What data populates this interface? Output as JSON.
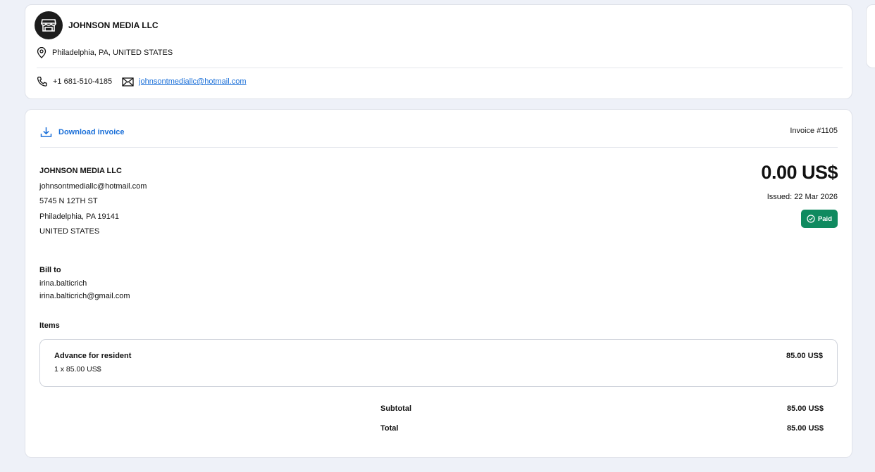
{
  "merchant": {
    "name": "JOHNSON MEDIA LLC",
    "location": "Philadelphia, PA, UNITED STATES",
    "phone": "+1 681-510-4185",
    "email": "johnsontmediallc@hotmail.com",
    "icons": {
      "avatar": "storefront-icon",
      "location": "map-pin-icon",
      "phone": "phone-icon",
      "email": "envelope-icon"
    }
  },
  "invoice": {
    "download_label": "Download invoice",
    "number": "Invoice #1105",
    "amount": "0.00 US$",
    "issued": "Issued: 22 Mar 2026",
    "status": "Paid",
    "status_color": "#0f8a5f",
    "accent_color": "#1a6fd8",
    "from": {
      "name": "JOHNSON MEDIA LLC",
      "email": "johnsontmediallc@hotmail.com",
      "street": "5745 N 12TH ST",
      "city": "Philadelphia, PA 19141",
      "country": "UNITED STATES"
    },
    "bill_to": {
      "label": "Bill to",
      "name": "irina.balticrich",
      "email": "irina.balticrich@gmail.com"
    },
    "items_label": "Items",
    "items": [
      {
        "name": "Advance for resident",
        "qty_price": "1 x 85.00 US$",
        "total": "85.00 US$"
      }
    ],
    "subtotal_label": "Subtotal",
    "subtotal": "85.00 US$",
    "total_label": "Total",
    "total": "85.00 US$"
  }
}
